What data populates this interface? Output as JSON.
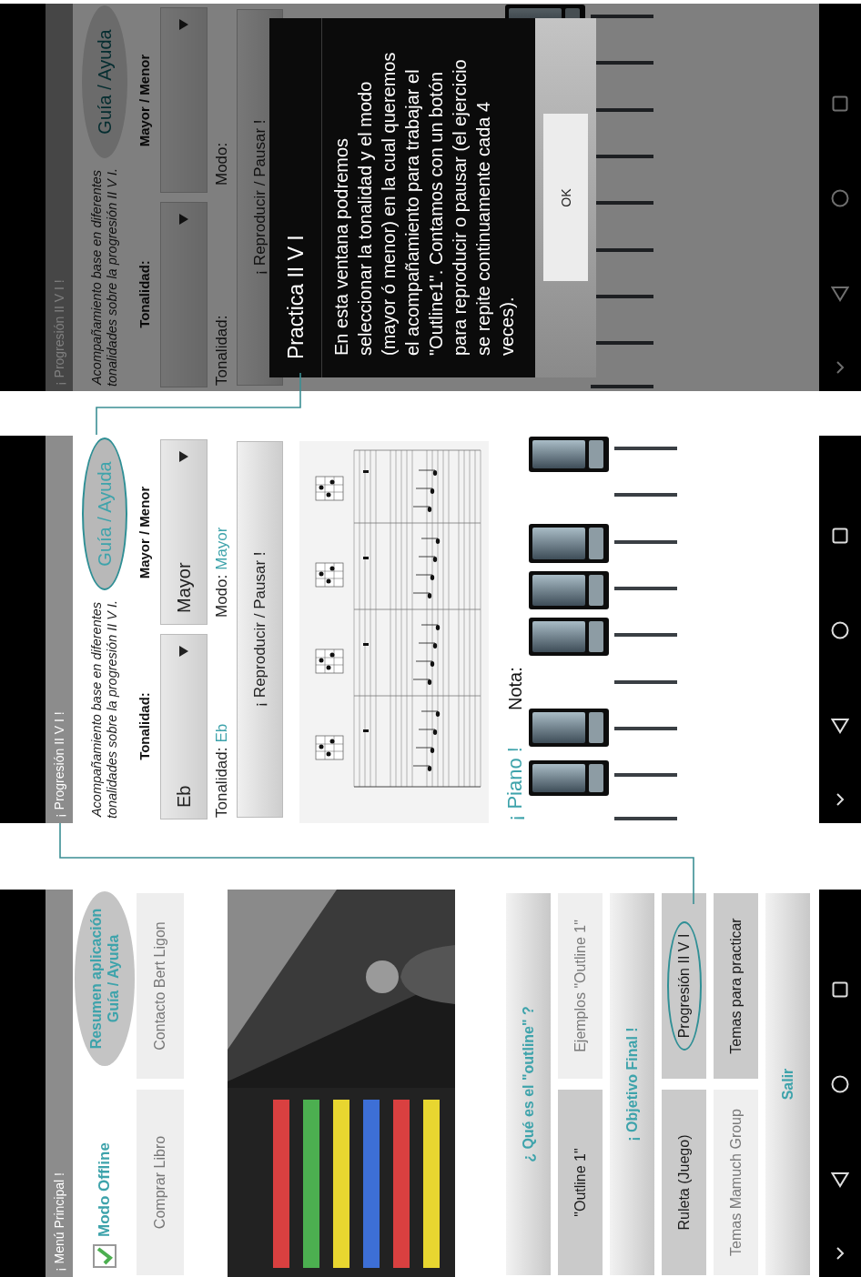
{
  "screens": [
    {
      "kind": "dialog",
      "title": "¡ Progresión II V I !",
      "description": "Acompañamiento base en diferentes tonalidades sobre la progresión II V I.",
      "help_button": {
        "label": "Guía / Ayuda",
        "highlighted": false
      },
      "key_label": "Tonalidad:",
      "mode_label": "Mayor / Menor",
      "key_status": {
        "label": "Tonalidad:"
      },
      "mode_status": {
        "label": "Modo:"
      },
      "play_button": "¡ Reproducir / Pausar !",
      "dialog": {
        "title": "Practica II V I",
        "body": "En esta ventana podremos seleccionar la tonalidad y el modo (mayor ó menor) en la cual queremos el acompañamiento para trabajar el \"Outline1\". Contamos con un botón para reproducir o pausar (el ejercicio se repite continuamente cada 4 veces).",
        "button": "OK"
      }
    },
    {
      "kind": "practice",
      "title": "¡ Progresión II V I !",
      "description": "Acompañamiento base en diferentes tonalidades sobre la progresión II V I.",
      "help_button": {
        "label": "Guía / Ayuda",
        "highlighted": true
      },
      "key_label": "Tonalidad:",
      "mode_label": "Mayor / Menor",
      "key_select": "Eb",
      "mode_select": "Mayor",
      "key_status": {
        "label": "Tonalidad:",
        "value": "Eb"
      },
      "mode_status": {
        "label": "Modo:",
        "value": "Mayor"
      },
      "play_button": "¡ Reproducir / Pausar !",
      "piano_label": "¡ Piano !",
      "note_label": "Nota:"
    },
    {
      "kind": "menu",
      "title": "¡ Menú Principal !",
      "offline": {
        "label": "Modo Offline",
        "checked": true
      },
      "summary_button": "Resumen aplicación\nGuía / Ayuda",
      "shop_buttons": [
        "Comprar Libro",
        "Contacto Bert Ligon"
      ],
      "picture": {
        "kind": "picture"
      },
      "menu_rows": [
        {
          "buttons": [
            {
              "kind": "section",
              "label": "¿ Qué es el \"outline\" ?",
              "highlighted": false
            }
          ]
        },
        {
          "buttons": [
            {
              "kind": "item",
              "label": "\"Outline 1\"",
              "highlighted": false
            },
            {
              "kind": "link",
              "label": "Ejemplos \"Outline 1\"",
              "highlighted": false
            }
          ]
        },
        {
          "buttons": [
            {
              "kind": "section",
              "label": "¡ Objetivo Final !",
              "highlighted": false
            }
          ]
        },
        {
          "buttons": [
            {
              "kind": "item",
              "label": "Ruleta (Juego)",
              "highlighted": false
            },
            {
              "kind": "item",
              "label": "Progresión II V I",
              "highlighted": true
            }
          ]
        },
        {
          "buttons": [
            {
              "kind": "link",
              "label": "Temas Mamuch Group",
              "highlighted": false
            },
            {
              "kind": "item",
              "label": "Temas para practicar",
              "highlighted": false
            }
          ]
        },
        {
          "buttons": [
            {
              "kind": "section",
              "label": "Salir",
              "highlighted": false
            }
          ]
        }
      ]
    }
  ]
}
